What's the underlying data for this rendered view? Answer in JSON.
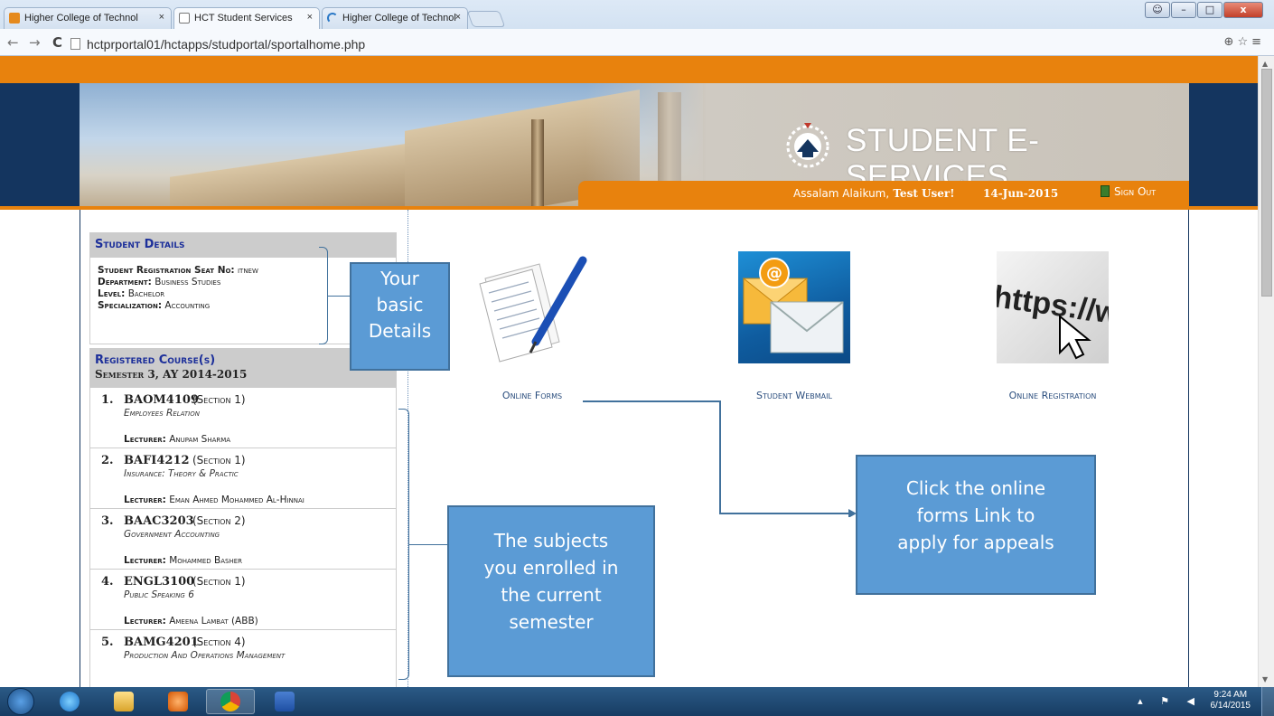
{
  "browser": {
    "tabs": [
      {
        "label": "Higher College of Technol",
        "close": "×"
      },
      {
        "label": "HCT Student Services",
        "close": "×"
      },
      {
        "label": "Higher College of Technol",
        "close": "×"
      }
    ],
    "url": "hctprportal01/hctapps/studportal/sportalhome.php",
    "back": "←",
    "forward": "→",
    "reload": "C",
    "zoom_star_menu": "⊕☆≡",
    "window_controls": {
      "minimize": "–",
      "maximize": "□",
      "close": "x"
    }
  },
  "banner": {
    "title": "STUDENT E-SERVICES",
    "greeting": "Assalam Alaikum,",
    "user": "Test User!",
    "date": "14-Jun-2015",
    "signout": "Sign Out"
  },
  "student_details": {
    "heading": "Student Details",
    "rows": [
      {
        "label": "Student Registration Seat No:",
        "value": "itnew"
      },
      {
        "label": "Department:",
        "value": "Business Studies"
      },
      {
        "label": "Level:",
        "value": "Bachelor"
      },
      {
        "label": "Specialization:",
        "value": "Accounting"
      }
    ]
  },
  "registered_courses": {
    "heading": "Registered Course(s)",
    "semester": "Semester 3, AY 2014-2015",
    "lecturer_label": "Lecturer:",
    "courses": [
      {
        "num": "1.",
        "code": "BAOM4109",
        "section": "(Section 1)",
        "name": "Employees Relation",
        "lecturer": "Anupam Sharma"
      },
      {
        "num": "2.",
        "code": "BAFI4212",
        "section": "(Section 1)",
        "name": "Insurance: Theory & Practic",
        "lecturer": "Eman Ahmed Mohammed Al-Hinnai"
      },
      {
        "num": "3.",
        "code": "BAAC3203",
        "section": "(Section 2)",
        "name": "Government Accounting",
        "lecturer": "Mohammed Basher"
      },
      {
        "num": "4.",
        "code": "ENGL3100",
        "section": "(Section 1)",
        "name": "Public Speaking 6",
        "lecturer": "Ameena Lambat (ABB)"
      },
      {
        "num": "5.",
        "code": "BAMG4201",
        "section": "(Section 4)",
        "name": "Production And Operations Management",
        "lecturer": ""
      }
    ]
  },
  "services": {
    "forms": {
      "label": "Online Forms",
      "icon": "document-pen-icon"
    },
    "webmail": {
      "label": "Student Webmail",
      "icon": "envelope-icon",
      "at": "@"
    },
    "registration": {
      "label": "Online Registration",
      "icon": "https-cursor-icon",
      "https": "https://www."
    }
  },
  "annotations": {
    "basic_details": "Your\nbasic\nDetails",
    "subjects": "The subjects\nyou enrolled in\nthe current\nsemester",
    "online_forms": "Click the online\nforms Link  to\napply for appeals"
  },
  "taskbar": {
    "time": "9:24 AM",
    "date": "6/14/2015",
    "tray_icons": "▴ ⚑ ◀"
  },
  "colors": {
    "orange": "#e8820d",
    "navy": "#14355f",
    "callout_blue": "#5b9bd5",
    "link_blue": "#2b4e7e",
    "heading_blue": "#1c2f9a"
  }
}
